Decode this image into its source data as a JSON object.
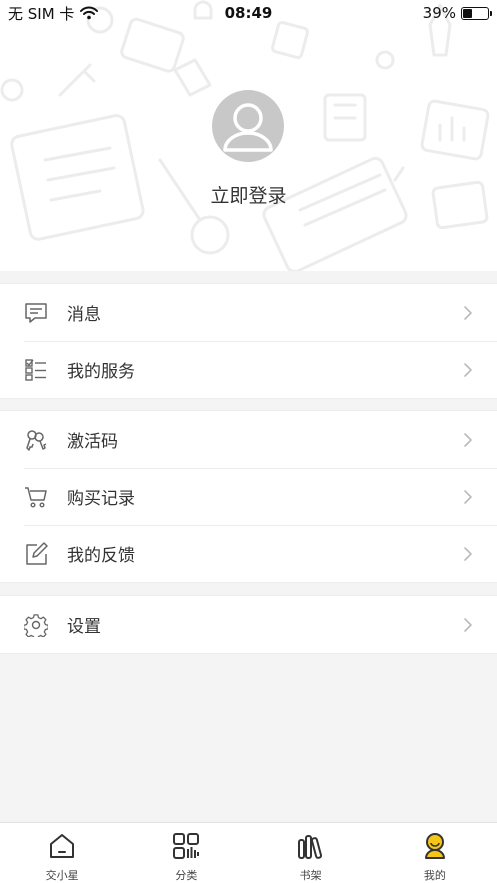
{
  "status_bar": {
    "carrier": "无 SIM 卡",
    "time": "08:49",
    "battery": "39%",
    "battery_level": 0.39
  },
  "profile": {
    "login_label": "立即登录"
  },
  "menu": {
    "group1": [
      {
        "label": "消息",
        "icon": "message-icon"
      },
      {
        "label": "我的服务",
        "icon": "checklist-icon"
      }
    ],
    "group2": [
      {
        "label": "激活码",
        "icon": "keys-icon"
      },
      {
        "label": "购买记录",
        "icon": "cart-icon"
      },
      {
        "label": "我的反馈",
        "icon": "edit-icon"
      }
    ],
    "group3": [
      {
        "label": "设置",
        "icon": "gear-icon"
      }
    ]
  },
  "tab_bar": {
    "tabs": [
      {
        "label": "交小星",
        "icon": "home-icon",
        "active": false
      },
      {
        "label": "分类",
        "icon": "grid-icon",
        "active": false
      },
      {
        "label": "书架",
        "icon": "bookshelf-icon",
        "active": false
      },
      {
        "label": "我的",
        "icon": "profile-icon",
        "active": true
      }
    ]
  },
  "colors": {
    "accent": "#f5c518",
    "avatar_bg": "#c8c8c8",
    "page_bg": "#f4f4f4"
  }
}
